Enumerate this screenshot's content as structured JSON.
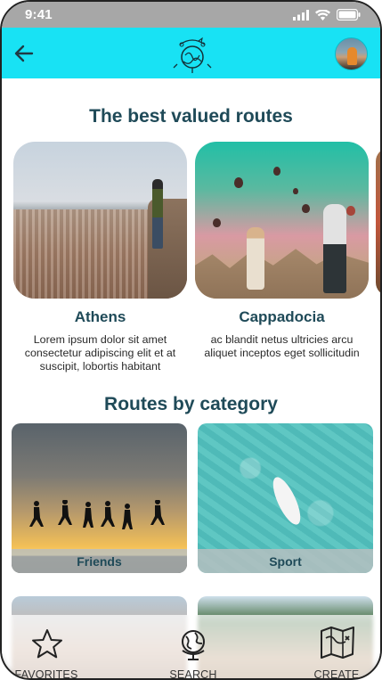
{
  "status_bar": {
    "time": "9:41"
  },
  "header": {
    "back_icon": "arrow-left-icon",
    "logo": "travel-logo",
    "avatar": "user-avatar"
  },
  "sections": {
    "best_routes_title": "The best valued routes",
    "categories_title": "Routes by category"
  },
  "routes": [
    {
      "name": "Athens",
      "description": "Lorem ipsum dolor sit amet consectetur adipiscing elit et at suscipit, lobortis habitant"
    },
    {
      "name": "Cappadocia",
      "description": "ac blandit netus ultricies arcu aliquet inceptos eget sollicitudin"
    }
  ],
  "categories": [
    {
      "label": "Friends"
    },
    {
      "label": "Sport"
    }
  ],
  "bottom_nav": [
    {
      "label": "FAVORITES",
      "icon": "star-icon"
    },
    {
      "label": "SEARCH",
      "icon": "globe-icon"
    },
    {
      "label": "CREATE",
      "icon": "map-icon"
    }
  ],
  "colors": {
    "header_bg": "#18e2f4",
    "title": "#1f4a58",
    "status_bar": "#a7a7a7"
  }
}
